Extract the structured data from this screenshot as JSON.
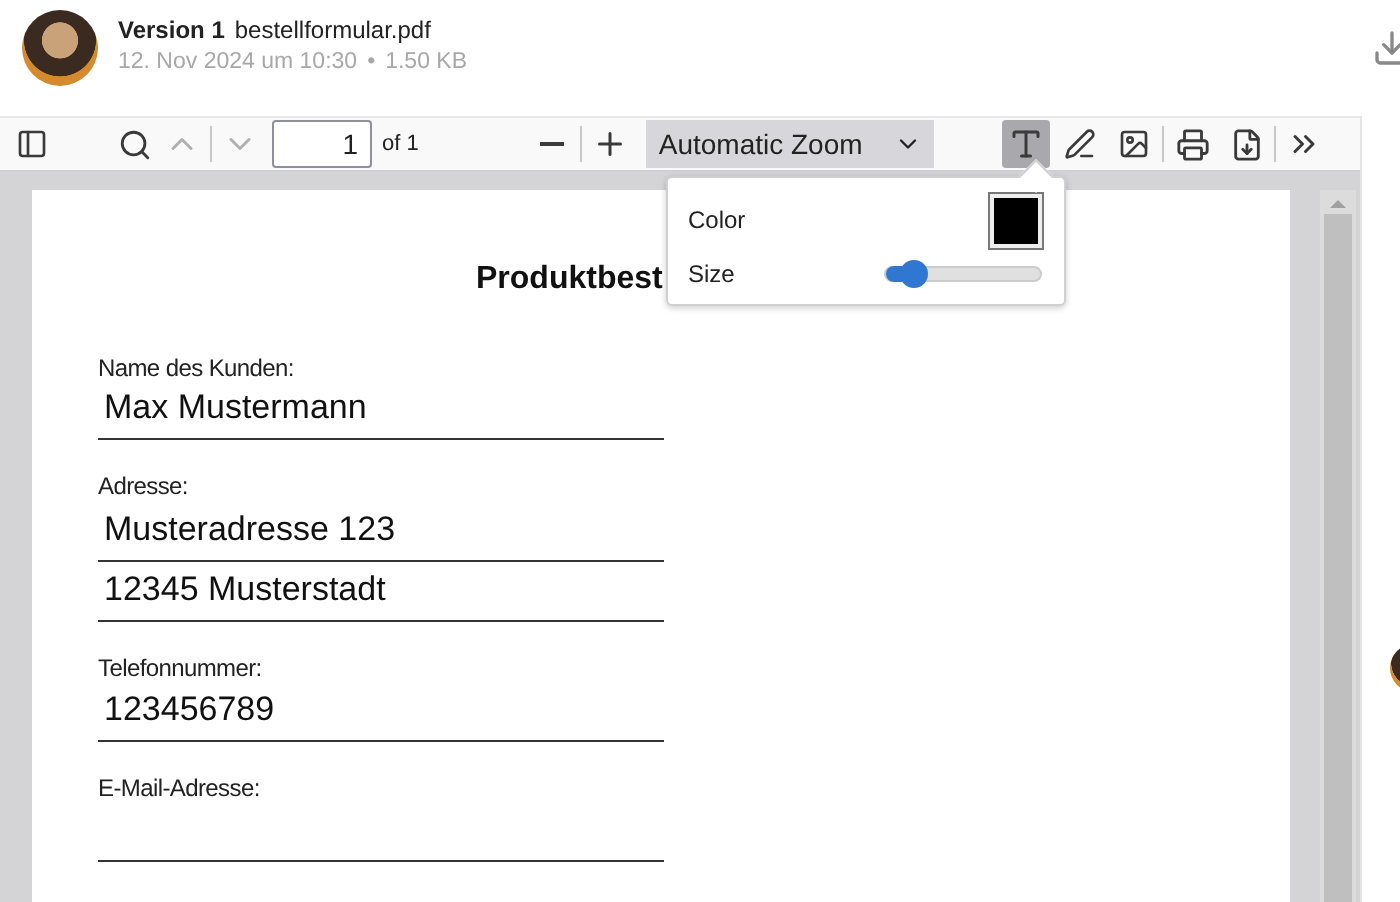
{
  "header": {
    "version": "Version 1",
    "filename": "bestellformular.pdf",
    "date": "12. Nov 2024 um 10:30",
    "separator": "•",
    "size": "1.50 KB"
  },
  "toolbar": {
    "page_number": "1",
    "page_count": "of 1",
    "zoom": "Automatic Zoom",
    "tools": [
      {
        "kind": "text",
        "selected": true
      },
      {
        "kind": "draw",
        "selected": false
      },
      {
        "kind": "image",
        "selected": false
      }
    ]
  },
  "editor_popup": {
    "color": {
      "label": "Color",
      "color": "#000000"
    },
    "size": {
      "label": "Size",
      "level": 0.18
    }
  },
  "document": {
    "title": "Produktbest",
    "fields": [
      {
        "label": "Name des Kunden:",
        "lines": [
          "Max Mustermann"
        ]
      },
      {
        "label": "Adresse:",
        "lines": [
          "Musteradresse 123",
          "12345 Musterstadt"
        ]
      },
      {
        "label": "Telefonnummer:",
        "lines": [
          "123456789"
        ]
      },
      {
        "label": "E-Mail-Adresse:"
      }
    ]
  }
}
